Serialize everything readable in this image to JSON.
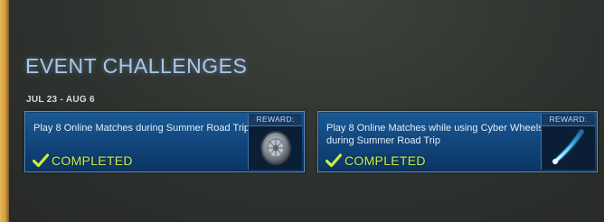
{
  "header": {
    "title": "EVENT CHALLENGES",
    "date_range": "JUL 23 - AUG 6"
  },
  "challenges": [
    {
      "description": "Play 8 Online Matches during Summer Road Trip",
      "status": "COMPLETED",
      "reward_label": "REWARD:",
      "reward_icon": "wheel-icon"
    },
    {
      "description": "Play 8 Online Matches while using Cyber Wheels during Summer Road Trip",
      "status": "COMPLETED",
      "reward_label": "REWARD:",
      "reward_icon": "boost-trail-icon"
    }
  ],
  "colors": {
    "completed": "#c9ee45",
    "title": "#a8c9e8",
    "card": "#1a5a96"
  }
}
